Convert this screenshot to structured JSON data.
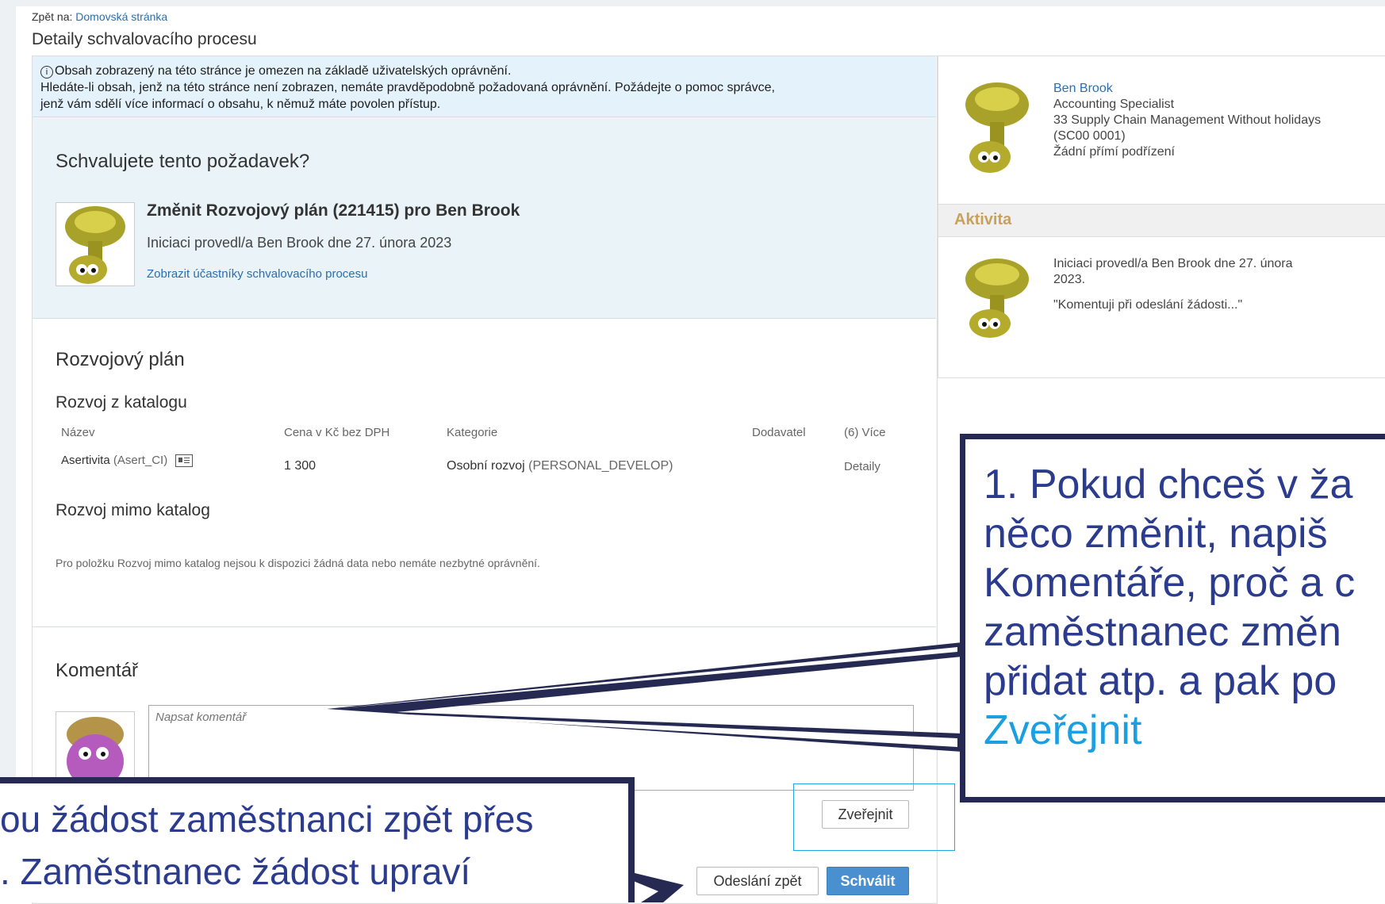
{
  "breadcrumb": {
    "prefix": "Zpět na:",
    "link": "Domovská stránka"
  },
  "page_title": "Detaily schvalovacího procesu",
  "info_banner": {
    "line1": "Obsah zobrazený na této stránce je omezen na základě uživatelských oprávnění.",
    "line2": "Hledáte-li obsah, jenž na této stránce není zobrazen, nemáte pravděpodobně požadovaná oprávnění. Požádejte o pomoc správce,",
    "line3": "jenž vám sdělí více informací o obsahu, k němuž máte povolen přístup."
  },
  "approval": {
    "question": "Schvalujete tento požadavek?",
    "request_title": "Změnit Rozvojový plán (221415) pro Ben Brook",
    "initiated": "Iniciaci provedl/a Ben Brook dne 27. února 2023",
    "participants_link": "Zobrazit účastníky schvalovacího procesu"
  },
  "dev_plan": {
    "title": "Rozvojový plán",
    "catalog_title": "Rozvoj z katalogu",
    "columns": [
      "Název",
      "Cena v Kč bez DPH",
      "Kategorie",
      "Dodavatel",
      "(6) Více"
    ],
    "row": {
      "name": "Asertivita",
      "code": "(Asert_CI)",
      "price": "1 300",
      "category": "Osobní rozvoj",
      "category_code": "(PERSONAL_DEVELOP)",
      "supplier": "",
      "more": "Detaily"
    },
    "non_catalog_title": "Rozvoj mimo katalog",
    "non_catalog_text": "Pro položku Rozvoj mimo katalog nejsou k dispozici žádná data nebo nemáte nezbytné oprávnění."
  },
  "comment": {
    "title": "Komentář",
    "placeholder": "Napsat komentář",
    "publish": "Zveřejnit",
    "send_back": "Odeslání zpět",
    "approve": "Schválit"
  },
  "profile": {
    "name": "Ben Brook",
    "role": "Accounting Specialist",
    "department": "33 Supply Chain Management Without holidays",
    "code": "(SC00 0001)",
    "reports": "Žádní přímí podřízení"
  },
  "activity": {
    "header": "Aktivita",
    "text1": "Iniciaci provedl/a Ben Brook dne 27. února",
    "text2": "2023.",
    "quote": "\"Komentuji při odeslání žádosti...\""
  },
  "callout_right": {
    "l1": "1. Pokud chceš v ža",
    "l2": "něco změnit, napiš",
    "l3": "Komentáře, proč a c",
    "l4": "zaměstnanec změn",
    "l5": "přidat atp. a pak po",
    "l6": "Zveřejnit"
  },
  "callout_left": {
    "l1": "ou žádost zaměstnanci zpět přes",
    "l2": ". Zaměstnanec žádost upraví"
  }
}
